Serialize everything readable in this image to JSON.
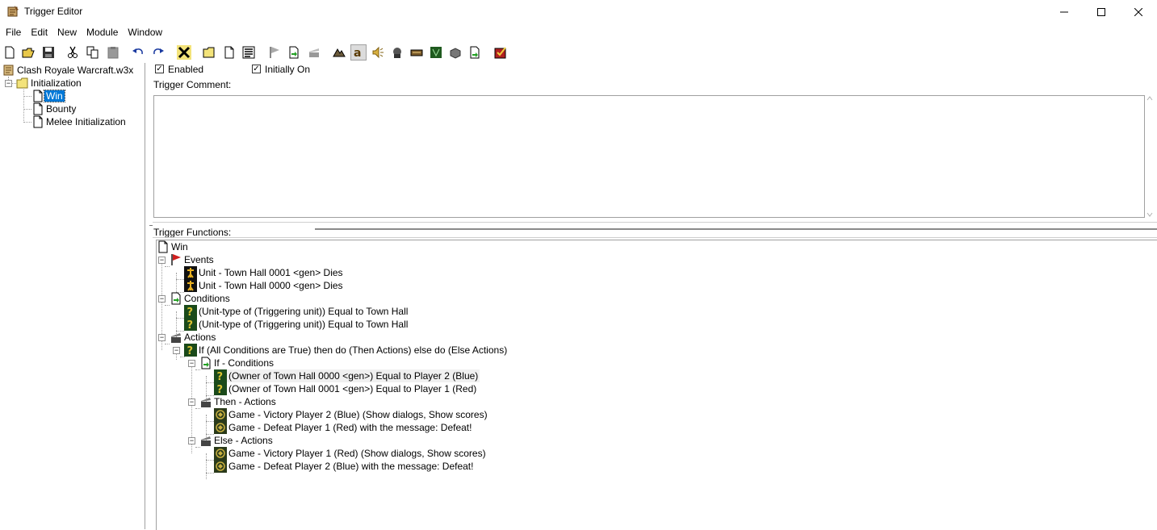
{
  "window": {
    "title": "Trigger Editor"
  },
  "menu": [
    "File",
    "Edit",
    "New",
    "Module",
    "Window"
  ],
  "toolbar_icons": [
    "new-icon",
    "open-icon",
    "save-icon",
    "cut-icon",
    "copy-icon",
    "paste-icon",
    "undo-icon",
    "redo-icon",
    "delete-icon",
    "new-category-icon",
    "new-trigger-icon",
    "new-comment-icon",
    "new-event-icon",
    "new-condition-icon",
    "new-action-icon",
    "terrain-editor-icon",
    "trigger-editor-icon",
    "sound-editor-icon",
    "object-editor-icon",
    "campaign-editor-icon",
    "ai-editor-icon",
    "object-manager-icon",
    "import-manager-icon",
    "test-map-icon"
  ],
  "tree": {
    "map_name": "Clash Royale Warcraft.w3x",
    "category": "Initialization",
    "triggers": [
      "Win",
      "Bounty",
      "Melee Initialization"
    ],
    "selected": "Win"
  },
  "trigger": {
    "enabled_label": "Enabled",
    "initially_on_label": "Initially On",
    "enabled": true,
    "initially_on": true,
    "comment_label": "Trigger Comment:",
    "comment": "",
    "functions_label": "Trigger Functions:"
  },
  "functions": {
    "root": "Win",
    "events_label": "Events",
    "events": [
      "Unit - Town Hall 0001 <gen> Dies",
      "Unit - Town Hall 0000 <gen> Dies"
    ],
    "conditions_label": "Conditions",
    "conditions": [
      "(Unit-type of (Triggering unit)) Equal to Town Hall",
      "(Unit-type of (Triggering unit)) Equal to Town Hall"
    ],
    "actions_label": "Actions",
    "if_action": "If (All Conditions are True) then do (Then Actions) else do (Else Actions)",
    "if_conditions_label": "If - Conditions",
    "if_conditions": [
      "(Owner of Town Hall 0000 <gen>) Equal to Player 2 (Blue)",
      "(Owner of Town Hall 0001 <gen>) Equal to Player 1 (Red)"
    ],
    "then_label": "Then - Actions",
    "then_actions": [
      "Game - Victory Player 2 (Blue) (Show dialogs, Show scores)",
      "Game - Defeat Player 1 (Red) with the message: Defeat!"
    ],
    "else_label": "Else - Actions",
    "else_actions": [
      "Game - Victory Player 1 (Red) (Show dialogs, Show scores)",
      "Game - Defeat Player 2 (Blue) with the message: Defeat!"
    ]
  }
}
